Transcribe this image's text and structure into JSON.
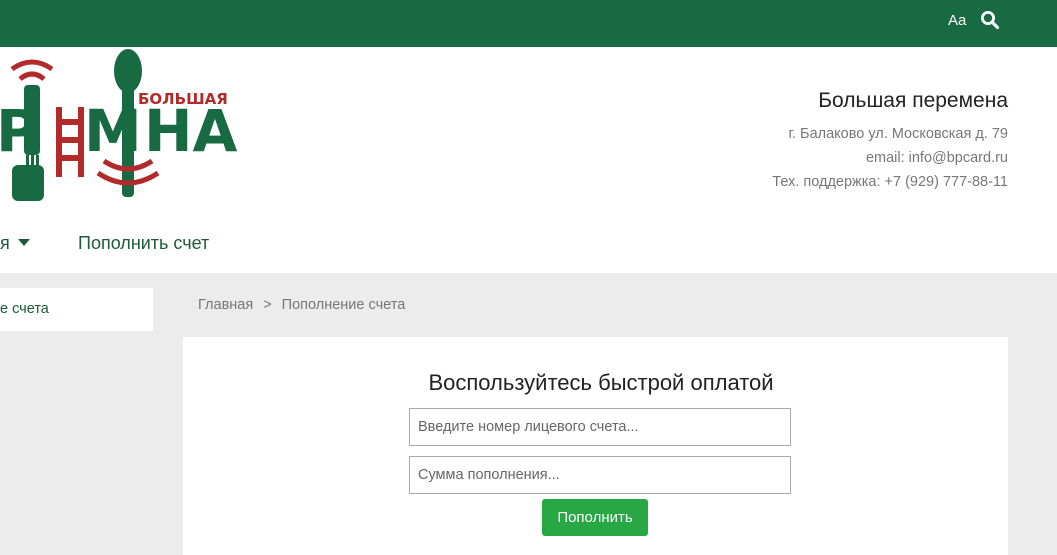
{
  "topbar": {
    "font_toggle_label": "Aa",
    "search_icon": "search-icon"
  },
  "logo": {
    "small_text": "БОЛЬШАЯ",
    "big_text": "ПЕРЕМЕНА"
  },
  "contacts": {
    "name": "Большая перемена",
    "address": "г. Балаково ул. Московская д. 79",
    "email": "email: info@bpcard.ru",
    "support": "Тех. поддержка: +7 (929) 777-88-11"
  },
  "nav": {
    "items": [
      {
        "label": "я",
        "has_dropdown": true
      },
      {
        "label": "Пополнить счет"
      }
    ]
  },
  "sidebar": {
    "active_item": "е счета"
  },
  "breadcrumb": {
    "home": "Главная",
    "separator": ">",
    "current": "Пополнение счета"
  },
  "payment": {
    "title": "Воспользуйтесь быстрой оплатой",
    "account_placeholder": "Введите номер лицевого счета...",
    "amount_placeholder": "Сумма пополнения...",
    "submit_label": "Пополнить"
  },
  "colors": {
    "brand_green": "#186a42",
    "logo_red": "#b22a2a",
    "button_green": "#28a745"
  }
}
